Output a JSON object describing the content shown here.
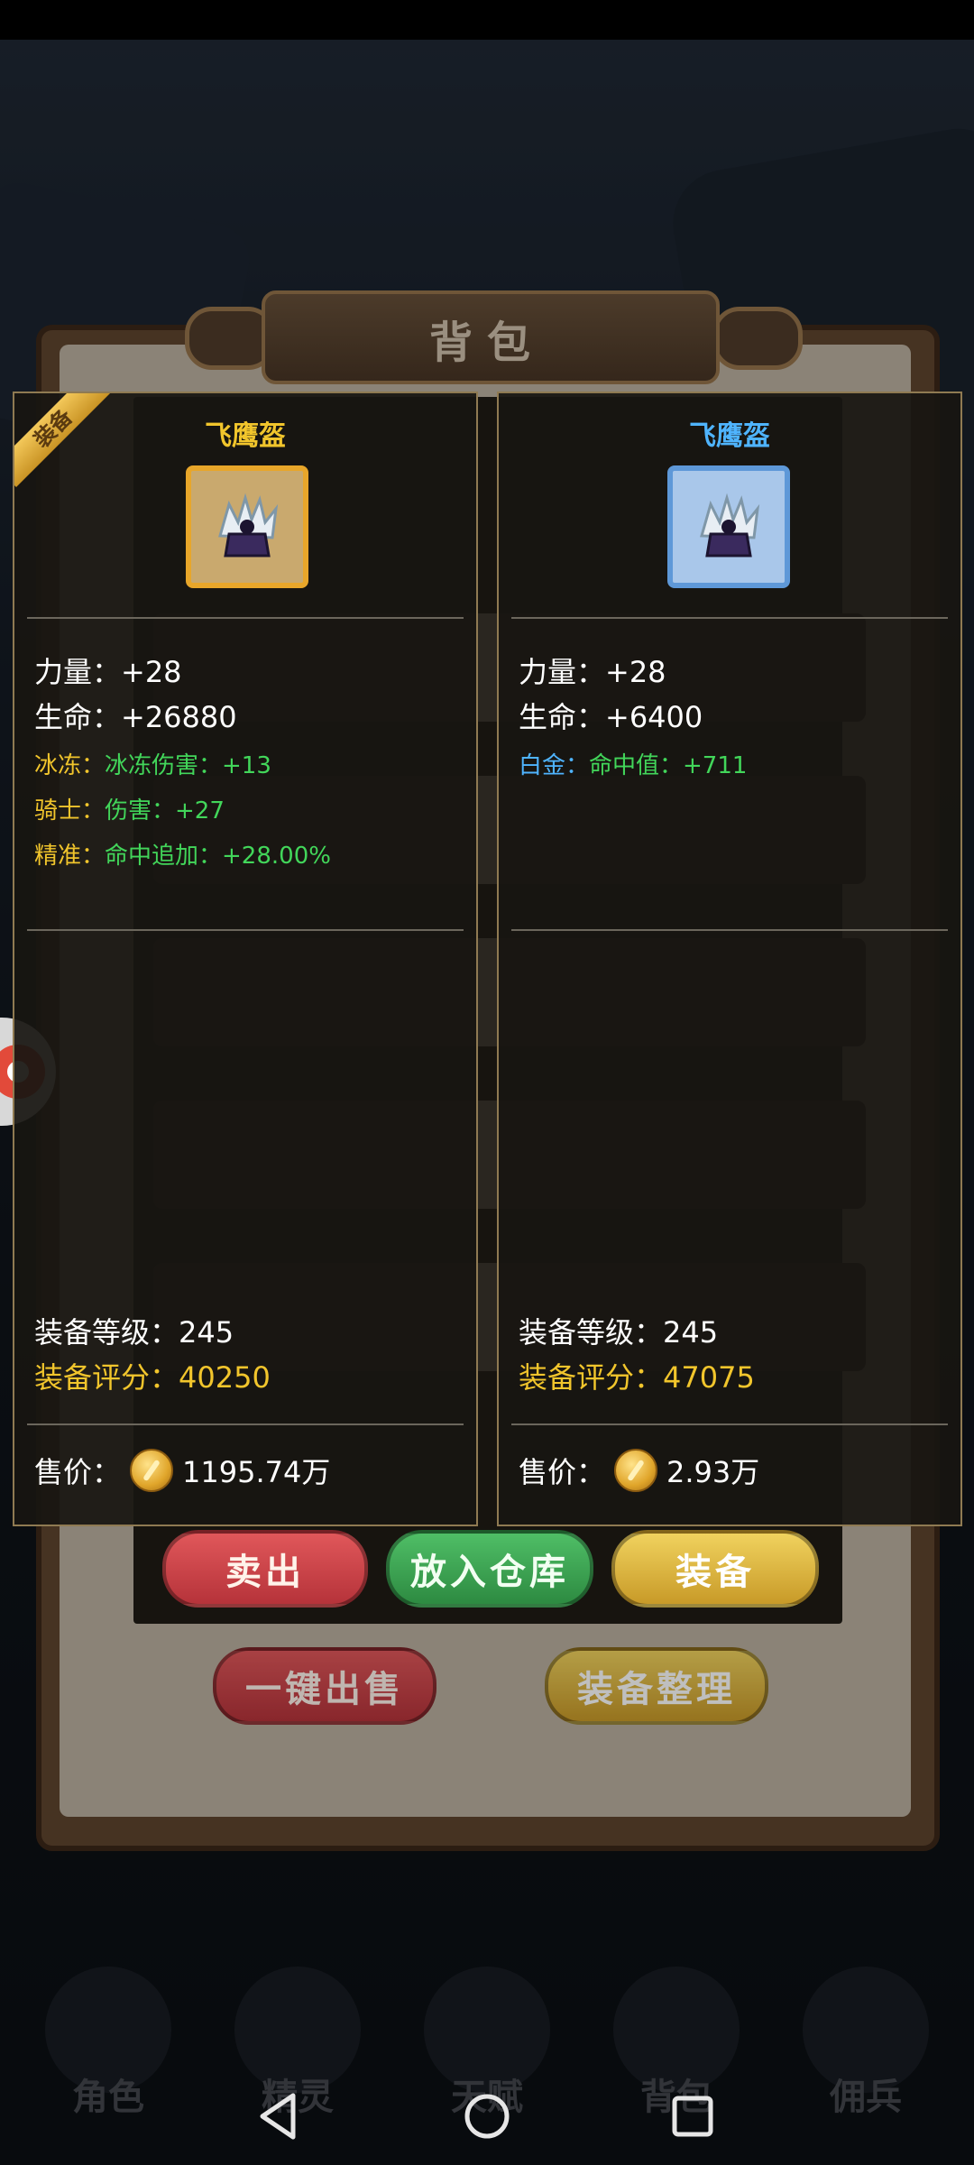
{
  "bag": {
    "title": "背包",
    "buttons": {
      "sell": "卖出",
      "store": "放入仓库",
      "equip": "装备",
      "sell_all": "一键出售",
      "sort": "装备整理"
    }
  },
  "equipped_card": {
    "badge": "装备",
    "name": "飞鹰盔",
    "name_color": "#f1c52c",
    "icon": "winged-helmet-icon",
    "stats": [
      {
        "text": "力量：+28"
      },
      {
        "text": "生命：+26880"
      }
    ],
    "special": [
      {
        "label": "冰冻：",
        "value": "冰冻伤害：+13"
      },
      {
        "label": "骑士：",
        "value": "伤害：+27"
      },
      {
        "label": "精准：",
        "value": "命中追加：+28.00%"
      }
    ],
    "level": "装备等级：245",
    "score": "装备评分：40250",
    "price_label": "售价：",
    "price": "1195.74万"
  },
  "compare_card": {
    "name": "飞鹰盔",
    "name_color": "#4fb4ff",
    "icon": "winged-helmet-icon",
    "stats": [
      {
        "text": "力量：+28"
      },
      {
        "text": "生命：+6400"
      }
    ],
    "special": [
      {
        "label": "白金：",
        "value": "命中值：+711"
      }
    ],
    "level": "装备等级：245",
    "score": "装备评分：47075",
    "price_label": "售价：",
    "price": "2.93万"
  },
  "game_nav": [
    {
      "label": "角色",
      "icon": "character-icon"
    },
    {
      "label": "精灵",
      "icon": "sprite-icon"
    },
    {
      "label": "天赋",
      "icon": "talent-icon"
    },
    {
      "label": "背包",
      "icon": "backpack-icon"
    },
    {
      "label": "佣兵",
      "icon": "mercenary-icon"
    }
  ],
  "colors": {
    "accent_gold": "#f1c52c",
    "green_stat": "#42d65a",
    "blue_stat": "#4fb4ff"
  }
}
